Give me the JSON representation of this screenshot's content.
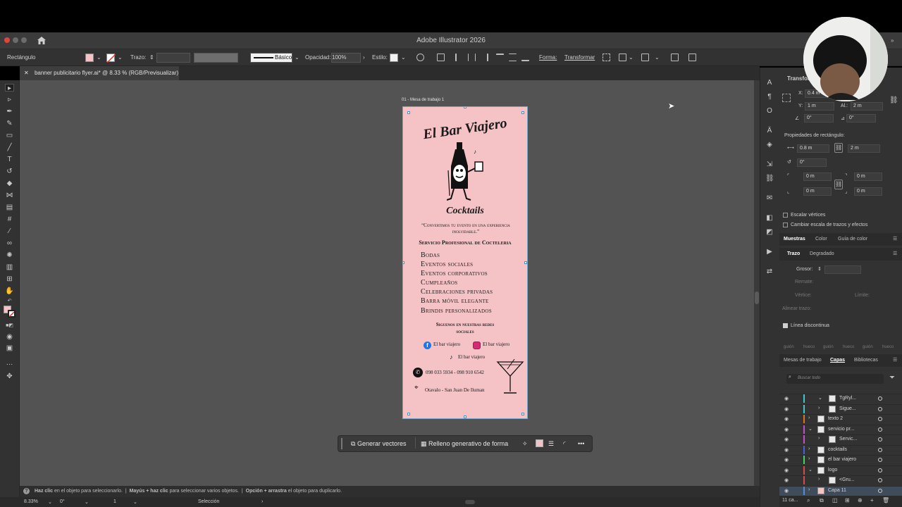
{
  "app": {
    "title": "Adobe Illustrator 2026"
  },
  "control_bar": {
    "selection_type": "Rectángulo",
    "stroke_label": "Trazo:",
    "stroke_profile": "Básico",
    "opacity_label": "Opacidad:",
    "opacity_value": "100%",
    "style_label": "Estilo:",
    "shape_label": "Forma:",
    "transform_label": "Transformar"
  },
  "document_tab": {
    "label": "banner publicitario flyer.ai* @ 8.33 % (RGB/Previsualizar)"
  },
  "artboard": {
    "label": "01 - Mesa de trabajo 1",
    "fill": "#f5c2c6",
    "flyer": {
      "brand_title": "El Bar Viajero",
      "brand_subtitle": "Cocktails",
      "tagline": "“Convertimos tu evento en una experiencia inolvidable.”",
      "heading": "Servicio Profesional de Cocteleria",
      "services": [
        "Bodas",
        "Eventos sociales",
        "Eventos corporativos",
        "Cumpleaños",
        "Celebraciones privadas",
        "Barra móvil elegante",
        "Brindis personalizados"
      ],
      "follow": "Siguenos en nuestras redes sociales",
      "facebook": "El bar viajero",
      "instagram": "El bar viajero",
      "tiktok": "El bar viajero",
      "phones": "098 033 5934 - 098 910 6542",
      "location": "Otavalo - San Juan De Iluman"
    }
  },
  "context_bar": {
    "generate_vectors": "Generar vectores",
    "generative_fill": "Relleno generativo de forma"
  },
  "status_bar": {
    "hint_1_bold": "Haz clic",
    "hint_1": "en el objeto para seleccionarlo.",
    "hint_2_bold": "Mayús + haz clic",
    "hint_2": "para seleccionar varios objetos.",
    "hint_3_bold": "Opción + arrastra",
    "hint_3": "el objeto para duplicarlo."
  },
  "bottom_bar": {
    "zoom": "8.33%",
    "rotation": "0°",
    "artboard_index": "1",
    "mode": "Selección"
  },
  "properties_panel": {
    "title": "Transfor",
    "x_label": "X:",
    "x_value": "0.4 m",
    "y_label": "Y:",
    "y_value": "1 m",
    "h_label": "Al.:",
    "h_value": "2 m",
    "angle_1": "0°",
    "angle_2": "0°",
    "rect_props_label": "Propiedades de rectángulo:",
    "rect_w": "0.8 m",
    "rect_h": "2 m",
    "corner_angle": "0°",
    "corner_tl": "0 m",
    "corner_tr": "0 m",
    "corner_bl": "0 m",
    "corner_br": "0 m",
    "scale_corners": "Escalar vértices",
    "scale_strokes": "Cambiar escala de trazos y efectos"
  },
  "swatches_tabs": [
    "Muestras",
    "Color",
    "Guía de color"
  ],
  "stroke_tabs": [
    "Trazo",
    "Degradado"
  ],
  "stroke_panel": {
    "weight_label": "Grosor:",
    "cap_label": "Remate:",
    "corner_label": "Vértice:",
    "limit_label": "Límite:",
    "align_label": "Alinear trazo:",
    "dashed_label": "Línea discontinua",
    "dash_labels": [
      "guión",
      "hueco",
      "guión",
      "hueco",
      "guión",
      "hueco"
    ]
  },
  "layers_tabs": [
    "Mesas de trabajo",
    "Capas",
    "Bibliotecas"
  ],
  "layers_panel": {
    "search_placeholder": "Buscar todo",
    "layers": [
      {
        "name": "TgRyl...",
        "color": "#3fc6c6"
      },
      {
        "name": "Sigue...",
        "color": "#3fc6c6"
      },
      {
        "name": "texto 2",
        "color": "#e0721f"
      },
      {
        "name": "servicio pr...",
        "color": "#c24ec9"
      },
      {
        "name": "Servic...",
        "color": "#c24ec9"
      },
      {
        "name": "cocktails",
        "color": "#4b5fd6"
      },
      {
        "name": "el bar viajero",
        "color": "#3fd65a"
      },
      {
        "name": "logo",
        "color": "#d64b4b"
      },
      {
        "name": "<Gru...",
        "color": "#d64b4b"
      },
      {
        "name": "Capa 11",
        "color": "#4b8fd6"
      }
    ],
    "footer": "11 ca..."
  }
}
